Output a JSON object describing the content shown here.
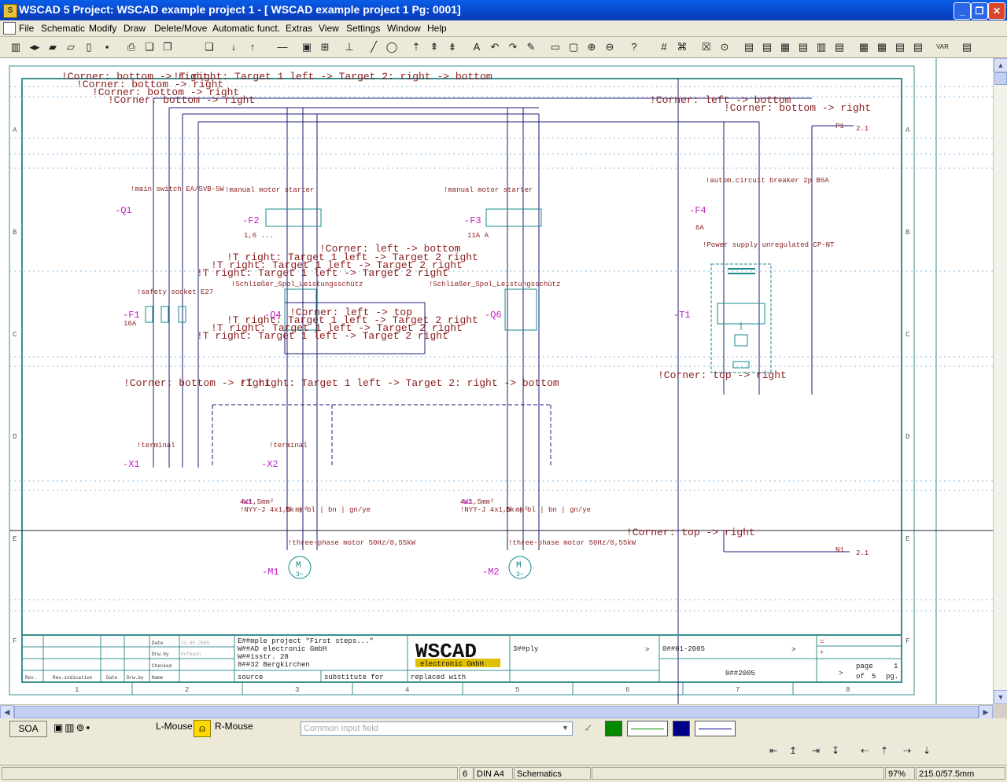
{
  "window": {
    "title": "WSCAD 5   Project: WSCAD example project 1 - [ WSCAD example project 1  Pg: 0001]",
    "icon_letter": "S"
  },
  "menu": [
    "File",
    "Schematic",
    "Modify",
    "Draw",
    "Delete/Move",
    "Automatic funct.",
    "Extras",
    "View",
    "Settings",
    "Window",
    "Help"
  ],
  "toolbar_icons": [
    "column-icon",
    "transfer-icon",
    "open-folder-icon",
    "open-icon",
    "new-page-icon",
    "save-icon",
    "print-icon",
    "copy-icon",
    "paste-icon",
    "copy2-icon",
    "arrow-down-icon",
    "arrow-up-icon",
    "line-icon",
    "symbol-icon",
    "connect-icon",
    "draw-line-icon",
    "ellipse-icon",
    "pin-icon",
    "pin2-icon",
    "pin3-icon",
    "text-icon",
    "undo-icon",
    "redo-icon",
    "pen-icon",
    "rectangle-icon",
    "zoom-window-icon",
    "zoom-in-icon",
    "zoom-out-icon",
    "help-icon"
  ],
  "drawing": {
    "rows": [
      "A",
      "B",
      "C",
      "D",
      "E",
      "F"
    ],
    "columns": [
      "1",
      "2",
      "3",
      "4",
      "5",
      "6",
      "7",
      "8"
    ],
    "components": [
      {
        "tag": "-Q1",
        "desc": "!main switch EA/SVB-5W"
      },
      {
        "tag": "-F2",
        "desc": "!manual motor starter"
      },
      {
        "tag": "-F3",
        "desc": "!manual motor starter"
      },
      {
        "tag": "-F4",
        "desc": "!autom.circuit breaker 2p B6A"
      },
      {
        "tag": "-F1",
        "desc": "!safety socket E27"
      },
      {
        "tag": "-Q4",
        "desc": "!Schließer_Spol_Leistungsschütz"
      },
      {
        "tag": "-Q6",
        "desc": "!Schließer_Spol_Leistungsschütz"
      },
      {
        "tag": "-T1",
        "desc": "!Power supply unregulated CP-NT"
      },
      {
        "tag": "-X1",
        "desc": "!terminal"
      },
      {
        "tag": "-X2",
        "desc": "!terminal"
      },
      {
        "tag": "-M1",
        "desc": "!three-phase motor 50Hz/0,55kW"
      },
      {
        "tag": "-M2",
        "desc": "!three-phase motor 50Hz/0,55kW"
      }
    ],
    "annotations": [
      "!Corner: bottom -> right",
      "!T right: Target 1 left -> Target 2: right -> bottom",
      "!Corner: left -> bottom",
      "!Corner: bottom -> right",
      "!Corner: left -> top",
      "!T right: Target 1 left -> Target 2 right",
      "!Corner: top -> right",
      "!Corner: top -> right"
    ],
    "cables": [
      {
        "tag": "-W1",
        "spec": "4x1,5mm²",
        "type": "!NYY-J 4x1,5 mm²",
        "cores": "bk | bl | bn | gn/ye"
      },
      {
        "tag": "-W2",
        "spec": "4x1,5mm²",
        "type": "!NYY-J 4x1,5 mm²",
        "cores": "bk | bl | bn | gn/ye"
      }
    ],
    "ratings": {
      "f2": "1,6 ...",
      "f3": "11A A",
      "f1": "16A",
      "f4": "6A"
    },
    "signals": {
      "p1": "P1",
      "n1": "N1",
      "ref": "2.1"
    },
    "title_block": {
      "project_lines": [
        "E##mple project \"First steps...\"",
        "W##AD electronic GmbH",
        "W##isstr. 28",
        "8##32 Bergkirchen"
      ],
      "labels": {
        "source": "source",
        "substitute": "substitute for",
        "replaced": "replaced with"
      },
      "logo_main": "WSCAD",
      "logo_sub": "electronic GmbH",
      "supply": "3##ply",
      "number": "0##01-2005",
      "year": "0##2005",
      "page_label": "page",
      "page_no": "1",
      "of_label": "of",
      "of_total": "5",
      "pg_label": "pg.",
      "rev_headers": [
        "Rev.",
        "Rev.indication",
        "Date",
        "Drw.by",
        "Name"
      ],
      "row_labels": [
        "Date",
        "Drw.by",
        "Checked"
      ],
      "date": "23.05.2005",
      "name": "Hofmann",
      "eq": "=",
      "plus": "+"
    }
  },
  "lower": {
    "soa": "SOA",
    "lmouse": "L-Mouse",
    "rmouse": "R-Mouse",
    "input_placeholder": "Common input field"
  },
  "status": {
    "count": "6",
    "paper": "DIN A4",
    "mode": "Schematics",
    "zoom": "97%",
    "coords": "215.0/57.5mm"
  },
  "colors": {
    "drawing_red": "#c0282c",
    "drawing_cyan": "#1a8a8a",
    "drawing_magenta": "#c020c0",
    "frame_teal": "#3a8f8f",
    "wire_navy": "#1c1c7a"
  }
}
